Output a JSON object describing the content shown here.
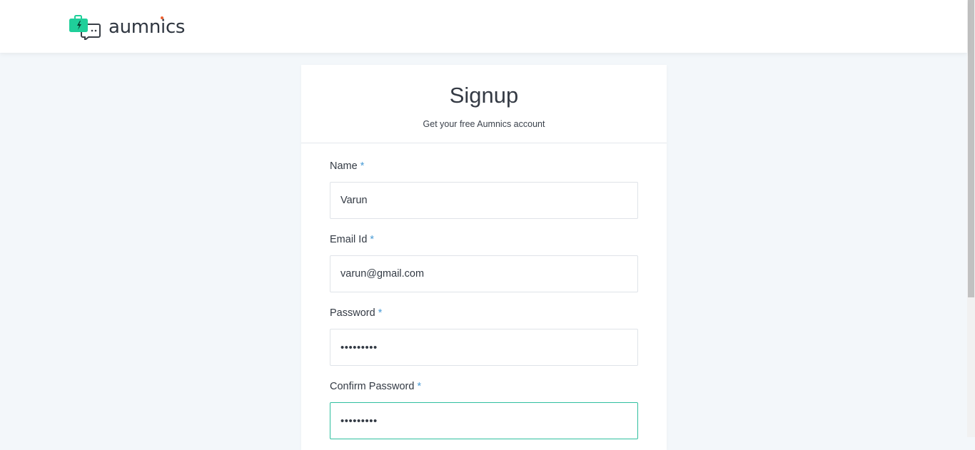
{
  "header": {
    "brand_name": "aumnics",
    "logo_icon": "chat-briefcase-icon",
    "brand_colors": {
      "icon_green": "#1fcf9a",
      "icon_dark": "#3a3f47",
      "dot_accent": "#f0602f"
    }
  },
  "signup": {
    "title": "Signup",
    "subtitle": "Get your free Aumnics account",
    "required_marker": "*",
    "fields": [
      {
        "label": "Name",
        "value": "Varun",
        "type": "text"
      },
      {
        "label": "Email Id",
        "value": "varun@gmail.com",
        "type": "email"
      },
      {
        "label": "Password",
        "value": "•••••••••",
        "type": "password"
      },
      {
        "label": "Confirm Password",
        "value": "•••••••••",
        "type": "password",
        "focused": true
      }
    ]
  },
  "colors": {
    "page_bg": "#f3f7fa",
    "required_star": "#4a9cd6",
    "focus_border": "#2fbf9f"
  }
}
